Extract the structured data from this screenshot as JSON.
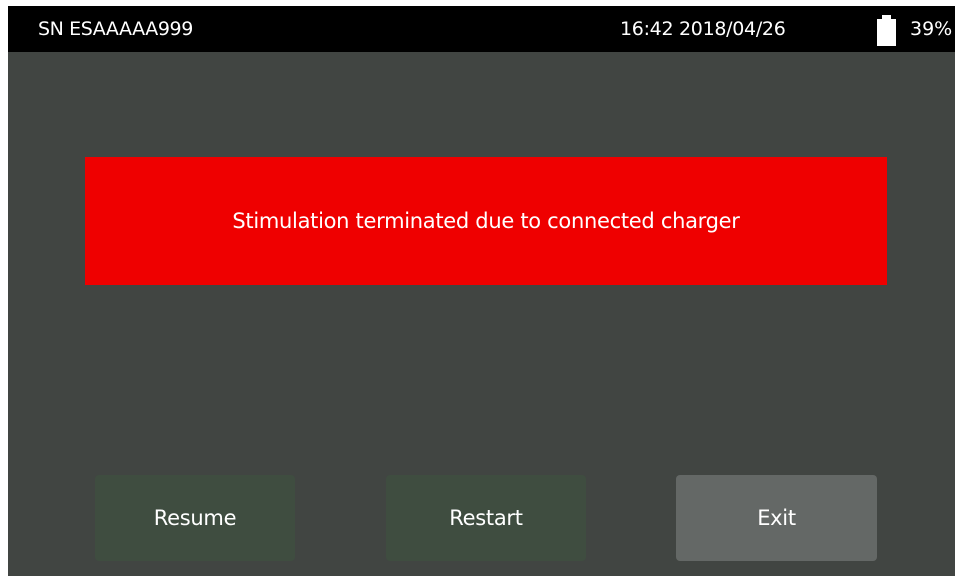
{
  "status_bar": {
    "serial": "SN ESAAAAA999",
    "datetime": "16:42 2018/04/26",
    "battery_icon": "battery-icon",
    "battery_percent": "39%"
  },
  "alert": {
    "message": "Stimulation terminated due to connected charger",
    "color": "#ef0000"
  },
  "buttons": {
    "resume": "Resume",
    "restart": "Restart",
    "exit": "Exit"
  },
  "colors": {
    "background": "#414542",
    "status_bar": "#000000",
    "button": "#3f4d40",
    "button_exit": "#646866"
  }
}
